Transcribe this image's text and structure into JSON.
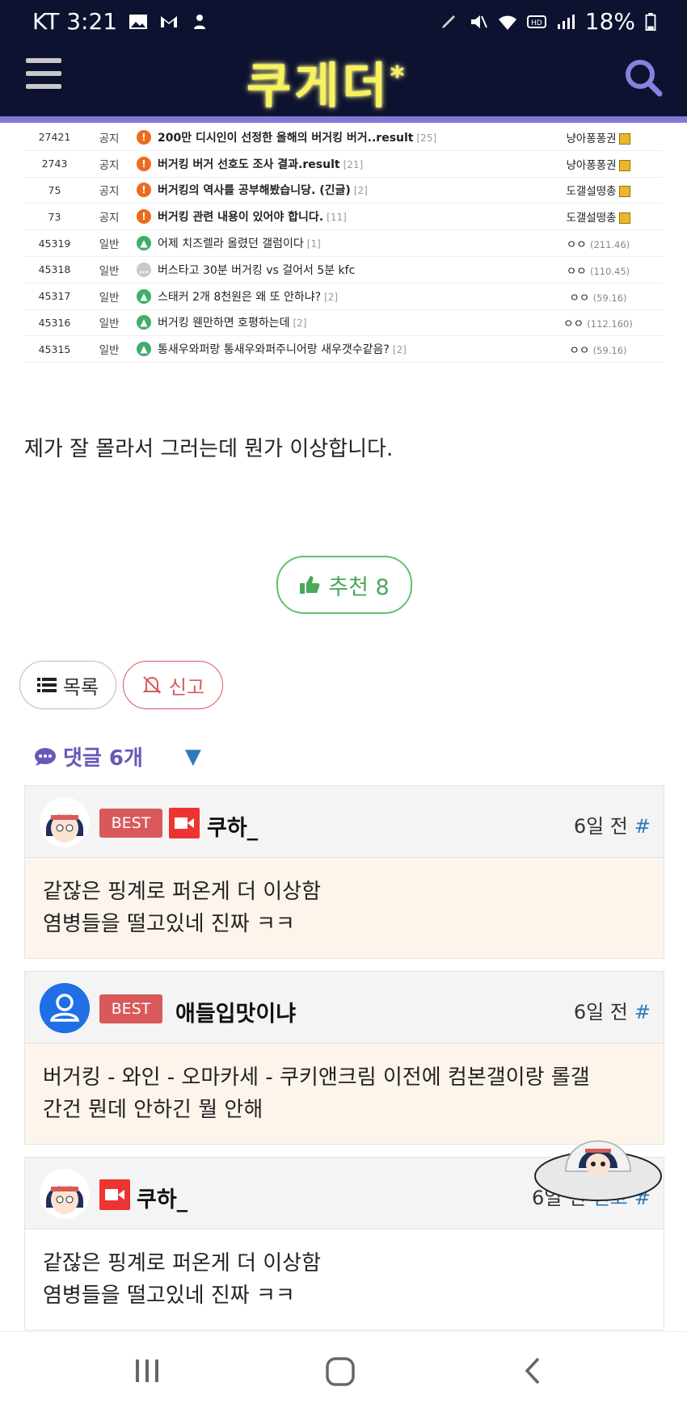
{
  "status_bar": {
    "carrier_time": "KT 3:21",
    "battery": "18%"
  },
  "header": {
    "logo": "쿠게더",
    "logo_star": "*"
  },
  "board": {
    "rows": [
      {
        "num": "27421",
        "type": "공지",
        "icon": "notice-icon",
        "title": "200만 디시인이 선정한 올해의 버거킹 버거..result",
        "comments": "[25]",
        "writer": "냥아퐁퐁권",
        "ip": "",
        "bold": true,
        "badge": true
      },
      {
        "num": "2743",
        "type": "공지",
        "icon": "notice-icon",
        "title": "버거킹 버거 선호도 조사 결과.result",
        "comments": "[21]",
        "writer": "냥아퐁퐁권",
        "ip": "",
        "bold": true,
        "badge": true
      },
      {
        "num": "75",
        "type": "공지",
        "icon": "notice-icon",
        "title": "버거킹의 역사를 공부해봤습니당. (긴글)",
        "comments": "[2]",
        "writer": "도갤설떵총",
        "ip": "",
        "bold": true,
        "badge": true
      },
      {
        "num": "73",
        "type": "공지",
        "icon": "notice-icon",
        "title": "버거킹 관련 내용이 있어야 합니다.",
        "comments": "[11]",
        "writer": "도갤설떵총",
        "ip": "",
        "bold": true,
        "badge": true
      },
      {
        "num": "45319",
        "type": "일반",
        "icon": "image-icon",
        "title": "어제 치즈렐라 올렸던 갤럼이다",
        "comments": "[1]",
        "writer": "ㅇㅇ",
        "ip": "(211.46)",
        "bold": false,
        "badge": false
      },
      {
        "num": "45318",
        "type": "일반",
        "icon": "chat-icon",
        "title": "버스타고 30분 버거킹 vs 걸어서 5분 kfc",
        "comments": "",
        "writer": "ㅇㅇ",
        "ip": "(110.45)",
        "bold": false,
        "badge": false
      },
      {
        "num": "45317",
        "type": "일반",
        "icon": "image-icon",
        "title": "스태커 2개 8천원은 왜 또 안하냐?",
        "comments": "[2]",
        "writer": "ㅇㅇ",
        "ip": "(59.16)",
        "bold": false,
        "badge": false
      },
      {
        "num": "45316",
        "type": "일반",
        "icon": "image-icon",
        "title": "버거킹 웬만하면 호평하는데",
        "comments": "[2]",
        "writer": "ㅇㅇ",
        "ip": "(112.160)",
        "bold": false,
        "badge": false
      },
      {
        "num": "45315",
        "type": "일반",
        "icon": "image-icon",
        "title": "통새우와퍼랑 통새우와퍼주니어랑 새우갯수같음?",
        "comments": "[2]",
        "writer": "ㅇㅇ",
        "ip": "(59.16)",
        "bold": false,
        "badge": false
      }
    ]
  },
  "post": {
    "text": "제가 잘 몰라서 그러는데 뭔가 이상합니다.",
    "like_label": "추천 8"
  },
  "actions": {
    "list_label": "목록",
    "report_label": "신고"
  },
  "comments": {
    "header": "댓글 6개",
    "items": [
      {
        "name": "쿠하_",
        "best": "BEST",
        "time": "6일 전",
        "hash": "#",
        "lines": [
          "같잖은 핑계로 퍼온게 더 이상함",
          "염병들을 떨고있네 진짜 ㅋㅋ"
        ]
      },
      {
        "name": "애들입맛이냐",
        "best": "BEST",
        "time": "6일 전",
        "hash": "#",
        "lines": [
          "버거킹 - 와인 - 오마카세 - 쿠키앤크림 이전에 컴본갤이랑 롤갤",
          "간건 뭔데 안하긴 뭘 안해"
        ]
      },
      {
        "name": "쿠하_",
        "best": "",
        "time": "6일 전",
        "report": "신고",
        "hash": "#",
        "lines": [
          "같잖은 핑계로 퍼온게 더 이상함",
          "염병들을 떨고있네 진짜 ㅋㅋ"
        ]
      }
    ]
  }
}
